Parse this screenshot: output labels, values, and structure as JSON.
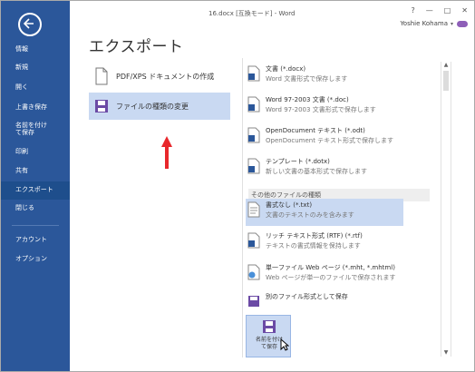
{
  "window": {
    "title": "16.docx [互換モード] - Word",
    "help": "?",
    "minimize": "—",
    "maximize": "□",
    "close": "✕",
    "user": "Yoshie Kohama",
    "user_menu": "▾"
  },
  "sidebar": {
    "items": [
      {
        "label": "情報"
      },
      {
        "label": "新規"
      },
      {
        "label": "開く"
      },
      {
        "label": "上書き保存"
      },
      {
        "label": "名前を付けて保存"
      },
      {
        "label": "印刷"
      },
      {
        "label": "共有"
      },
      {
        "label": "エクスポート"
      },
      {
        "label": "閉じる"
      },
      {
        "label": "アカウント"
      },
      {
        "label": "オプション"
      }
    ]
  },
  "main": {
    "heading": "エクスポート",
    "options": [
      {
        "label": "PDF/XPS ドキュメントの作成"
      },
      {
        "label": "ファイルの種類の変更"
      }
    ]
  },
  "filetypes": {
    "items": [
      {
        "title": "文書 (*.docx)",
        "desc": "Word 文書形式で保存します"
      },
      {
        "title": "Word 97-2003 文書 (*.doc)",
        "desc": "Word 97-2003 文書形式で保存します"
      },
      {
        "title": "OpenDocument テキスト (*.odt)",
        "desc": "OpenDocument テキスト形式で保存します"
      },
      {
        "title": "テンプレート (*.dotx)",
        "desc": "新しい文書の基本形式で保存します"
      }
    ],
    "other_header": "その他のファイルの種類",
    "other_items": [
      {
        "title": "書式なし (*.txt)",
        "desc": "文書のテキストのみを含みます"
      },
      {
        "title": "リッチ テキスト形式 (RTF) (*.rtf)",
        "desc": "テキストの書式情報を保持します"
      },
      {
        "title": "単一ファイル Web ページ (*.mht, *.mhtml)",
        "desc": "Web ページが単一のファイルで保存されます"
      },
      {
        "title": "別のファイル形式として保存",
        "desc": ""
      }
    ],
    "saveas_button": "名前を付けて保存"
  },
  "colors": {
    "sidebar": "#2b579a",
    "selected": "#c9d9f2",
    "arrow": "#e8272b"
  }
}
